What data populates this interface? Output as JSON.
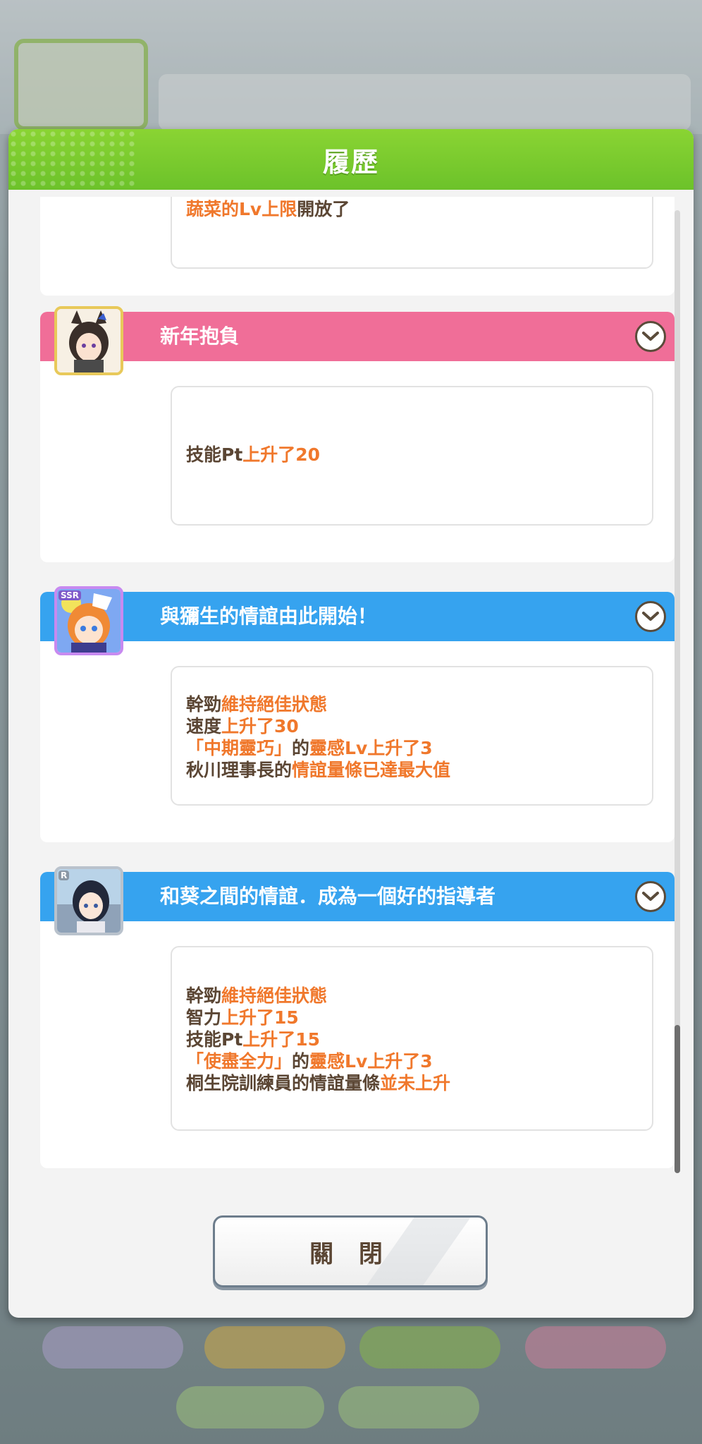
{
  "dialog": {
    "title": "履歷",
    "close_label": "關 閉"
  },
  "entries": [
    {
      "title": "",
      "lines": [
        [
          {
            "t": "蔬菜的Lv上限",
            "h": true
          },
          {
            "t": "開放了",
            "h": false
          }
        ]
      ]
    },
    {
      "title": "新年抱負",
      "head_color": "#f06e98",
      "lines": [
        [
          {
            "t": "技能Pt",
            "h": false
          },
          {
            "t": "上升了20",
            "h": true
          }
        ]
      ]
    },
    {
      "title": "與獼生的情誼由此開始！",
      "head_color": "#36a3ef",
      "badge": "SSR",
      "lines": [
        [
          {
            "t": "幹勁",
            "h": false
          },
          {
            "t": "維持絕佳狀態",
            "h": true
          }
        ],
        [
          {
            "t": "速度",
            "h": false
          },
          {
            "t": "上升了30",
            "h": true
          }
        ],
        [
          {
            "t": "「中期靈巧」",
            "h": true
          },
          {
            "t": "的",
            "h": false
          },
          {
            "t": "靈感Lv上升了3",
            "h": true
          }
        ],
        [
          {
            "t": "秋川理事長的",
            "h": false
          },
          {
            "t": "情誼量條已達最大值",
            "h": true
          }
        ]
      ]
    },
    {
      "title": "和葵之間的情誼．成為一個好的指導者",
      "head_color": "#36a3ef",
      "badge": "R",
      "lines": [
        [
          {
            "t": "幹勁",
            "h": false
          },
          {
            "t": "維持絕佳狀態",
            "h": true
          }
        ],
        [
          {
            "t": "智力",
            "h": false
          },
          {
            "t": "上升了15",
            "h": true
          }
        ],
        [
          {
            "t": "技能Pt",
            "h": false
          },
          {
            "t": "上升了15",
            "h": true
          }
        ],
        [
          {
            "t": "「使盡全力」",
            "h": true
          },
          {
            "t": "的",
            "h": false
          },
          {
            "t": "靈感Lv上升了3",
            "h": true
          }
        ],
        [
          {
            "t": "桐生院訓練員的情誼量條",
            "h": false
          },
          {
            "t": "並未上升",
            "h": true
          }
        ]
      ]
    }
  ],
  "colors": {
    "accent_green": "#6cc22a",
    "highlight_orange": "#f0782c",
    "text_brown": "#5b4634"
  },
  "icons": {
    "chevron": "chevron-down-icon"
  }
}
